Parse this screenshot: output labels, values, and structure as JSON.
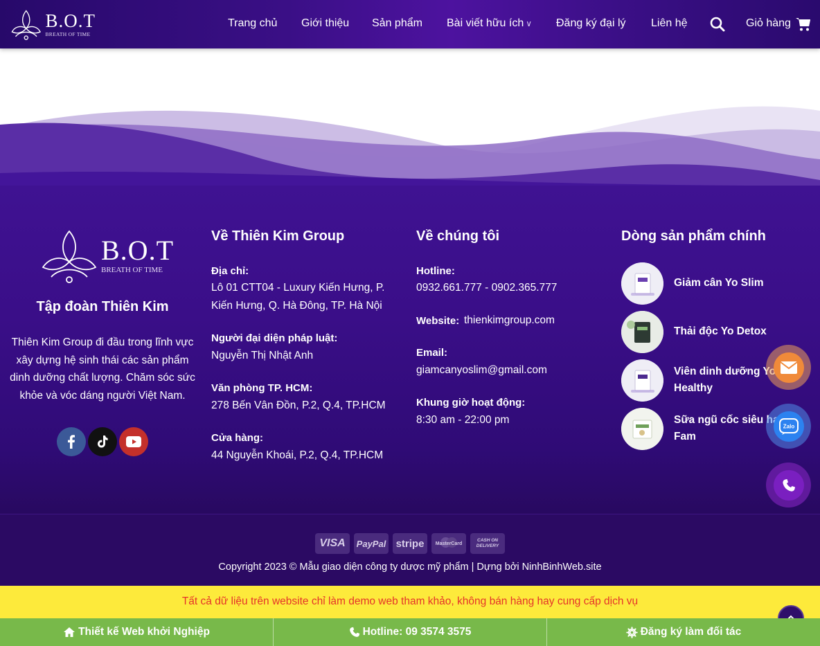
{
  "header": {
    "logo_text": "B.O.T",
    "logo_sub": "BREATH OF TIME",
    "nav": [
      {
        "label": "Trang chủ"
      },
      {
        "label": "Giới thiệu"
      },
      {
        "label": "Sản phẩm"
      },
      {
        "label": "Bài viết hữu ích"
      },
      {
        "label": "Đăng ký đại lý"
      },
      {
        "label": "Liên hệ"
      }
    ],
    "cart_label": "Giỏ hàng"
  },
  "footer": {
    "brand": {
      "logo_text": "B.O.T",
      "logo_sub": "BREATH OF TIME",
      "title": "Tập đoàn Thiên Kim",
      "description": "Thiên Kim Group đi đầu trong lĩnh vực xây dựng hệ sinh thái các sản phẩm dinh dưỡng chất lượng. Chăm sóc sức khỏe và vóc dáng người Việt Nam."
    },
    "about": {
      "heading": "Về Thiên Kim Group",
      "address_label": "Địa chỉ:",
      "address_line1": "Lô 01 CTT04 - Luxury Kiến Hưng, P.",
      "address_line2": "Kiến Hưng, Q. Hà Đông, TP. Hà Nội",
      "rep_label": "Người đại diện pháp luật:",
      "rep_value": "Nguyễn Thị Nhật Anh",
      "office_label": "Văn phòng TP. HCM:",
      "office_value": "278 Bến Vân Đồn, P.2, Q.4, TP.HCM",
      "store_label": "Cửa hàng:",
      "store_value": "44 Nguyễn Khoái, P.2, Q.4, TP.HCM"
    },
    "contact": {
      "heading": "Về chúng tôi",
      "hotline_label": "Hotline:",
      "hotline_value": "0932.661.777 - 0902.365.777",
      "website_label": "Website:",
      "website_value": "thienkimgroup.com",
      "email_label": "Email:",
      "email_value": "giamcanyoslim@gmail.com",
      "hours_label": "Khung giờ hoạt động:",
      "hours_value": "8:30 am - 22:00 pm"
    },
    "products": {
      "heading": "Dòng sản phẩm chính",
      "items": [
        {
          "name": "Giảm cân Yo Slim"
        },
        {
          "name": "Thải độc Yo Detox"
        },
        {
          "name_line1": "Viên dinh dưỡng Yo",
          "name_line2": "Healthy"
        },
        {
          "name_line1": "Sữa ngũ cốc siêu hạt Yo",
          "name_line2": "Fam"
        }
      ]
    },
    "payments": [
      "VISA",
      "PayPal",
      "stripe",
      "MasterCard",
      "CASH ON DELIVERY"
    ],
    "copyright": "Copyright 2023 © Mẫu giao diện công ty dược mỹ phẩm | Dựng bởi NinhBinhWeb.site"
  },
  "notice": "Tất cả dữ liệu trên website chỉ làm demo web tham khảo, không bán hàng hay cung cấp dịch vụ",
  "cta": {
    "web": "Thiết kế Web khởi Nghiệp",
    "hotline": "Hotline: 09 3574 3575",
    "partner": "Đăng ký làm đối tác"
  },
  "floating": {
    "zalo": "Zalo"
  }
}
